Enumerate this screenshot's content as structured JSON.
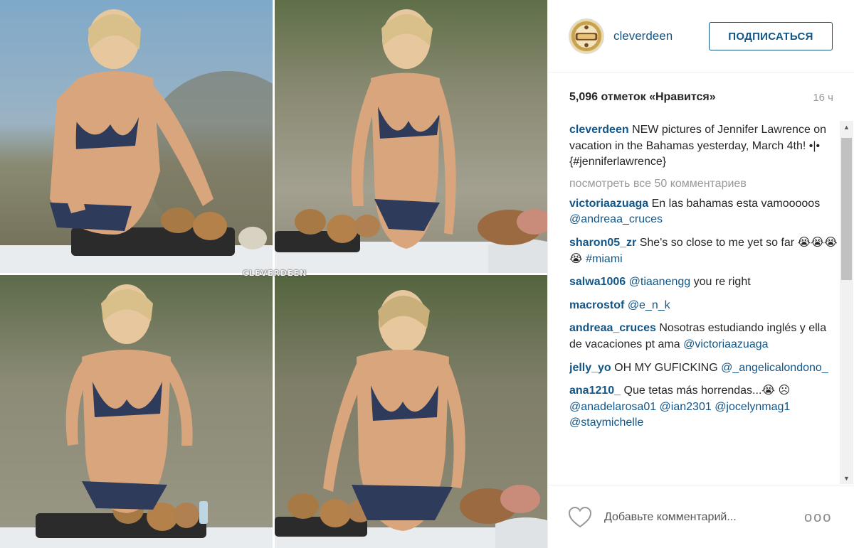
{
  "post": {
    "watermark": "CLEVERDEEN",
    "photos": [
      {
        "name": "photo-top-left"
      },
      {
        "name": "photo-top-right"
      },
      {
        "name": "photo-bottom-left"
      },
      {
        "name": "photo-bottom-right"
      }
    ]
  },
  "header": {
    "avatar_icon": "profile-avatar",
    "username": "cleverdeen",
    "follow_label": "ПОДПИСАТЬСЯ"
  },
  "stats": {
    "likes": "5,096 отметок «Нравится»",
    "time": "16 ч"
  },
  "caption": {
    "user": "cleverdeen",
    "text": "NEW pictures of Jennifer Lawrence on vacation in the Bahamas yesterday, March 4th! •|• {#jenniferlawrence}"
  },
  "view_all": "посмотреть все 50 комментариев",
  "comments": [
    {
      "user": "victoriaazuaga",
      "text": "En las bahamas esta vamooooos ",
      "tags": "@andreaa_cruces"
    },
    {
      "user": "sharon05_zr",
      "text": "She's so close to me yet so far 😭😭😭😭 ",
      "tags": "#miami"
    },
    {
      "user": "salwa1006",
      "text": "",
      "tags": "@tiaanengg",
      "after": " you re right"
    },
    {
      "user": "macrostof",
      "text": "",
      "tags": "@e_n_k"
    },
    {
      "user": "andreaa_cruces",
      "text": "Nosotras estudiando inglés y ella de vacaciones pt ama ",
      "tags": "@victoriaazuaga"
    },
    {
      "user": "jelly_yo",
      "text": "OH MY GUFICKING ",
      "tags": "@_angelicalondono_"
    },
    {
      "user": "ana1210_",
      "text": "Que tetas más horrendas...😭 ☹ ",
      "tags": "@anadelarosa01 @ian2301 @jocelynmag1 @staymichelle"
    }
  ],
  "footer": {
    "heart_icon": "heart-icon",
    "comment_placeholder": "Добавьте комментарий...",
    "more_label": "ooo"
  }
}
